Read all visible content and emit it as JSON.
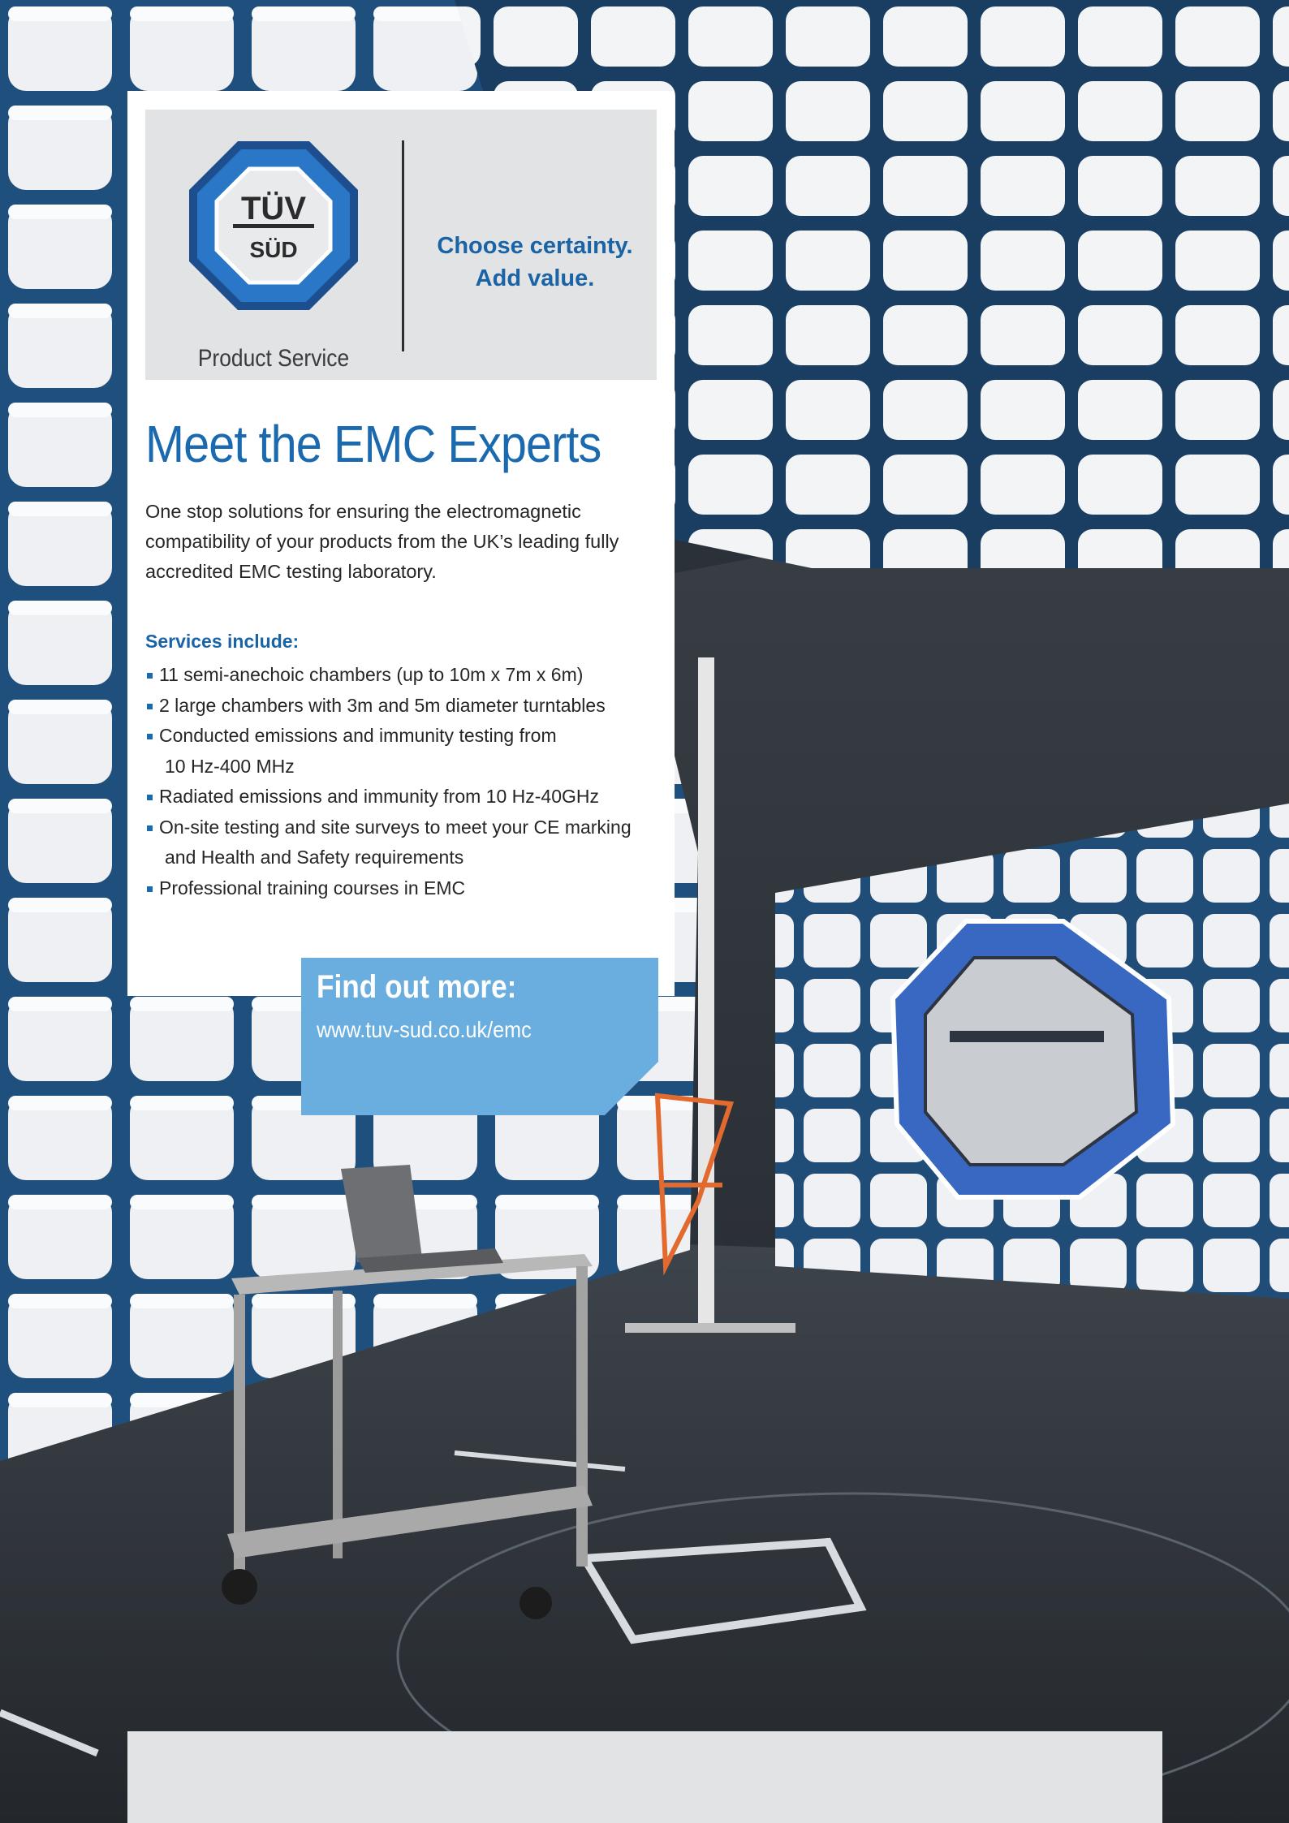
{
  "brand": {
    "logo_top": "TÜV",
    "logo_bottom": "SÜD",
    "division": "Product Service",
    "tagline_line1": "Choose certainty.",
    "tagline_line2": "Add value."
  },
  "headline": "Meet the EMC Experts",
  "intro": "One stop solutions for ensuring the electromagnetic compatibility of your products from the UK’s leading fully accredited EMC testing laboratory.",
  "services": {
    "title": "Services include:",
    "items": [
      {
        "line1": "11 semi-anechoic chambers (up to 10m x 7m x 6m)",
        "line2": ""
      },
      {
        "line1": "2 large chambers with 3m and 5m diameter turntables",
        "line2": ""
      },
      {
        "line1": "Conducted emissions and immunity testing from",
        "line2": "10 Hz-400 MHz"
      },
      {
        "line1": "Radiated emissions and immunity from 10 Hz-40GHz",
        "line2": ""
      },
      {
        "line1": "On-site testing and site surveys to meet your CE marking",
        "line2": "and Health and Safety requirements"
      },
      {
        "line1": "Professional training courses in EMC",
        "line2": ""
      }
    ]
  },
  "cta": {
    "title": "Find out more:",
    "url": "www.tuv-sud.co.uk/emc"
  },
  "colors": {
    "brand_blue": "#1b6ab0",
    "cta_blue": "#6aaee0",
    "panel_grey": "#e2e3e5"
  }
}
